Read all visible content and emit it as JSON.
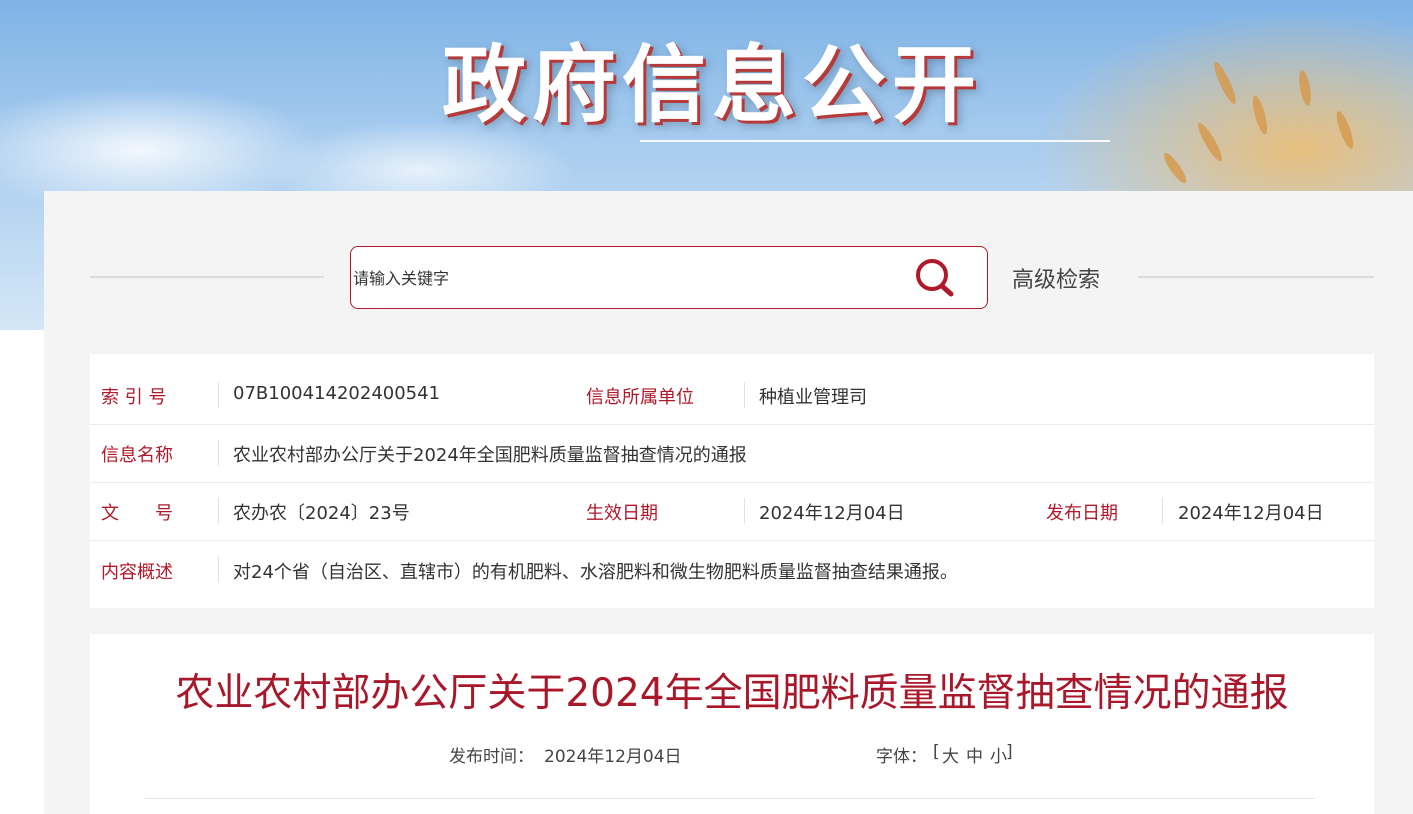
{
  "banner": {
    "title": "政府信息公开"
  },
  "search": {
    "placeholder": "请输入关键字",
    "value": "",
    "advanced_label": "高级检索"
  },
  "info": {
    "index_label": "索 引 号",
    "index_value": "07B100414202400541",
    "unit_label": "信息所属单位",
    "unit_value": "种植业管理司",
    "name_label": "信息名称",
    "name_value": "农业农村部办公厅关于2024年全国肥料质量监督抽查情况的通报",
    "doc_no_label": "文　　号",
    "doc_no_value": "农办农〔2024〕23号",
    "effective_label": "生效日期",
    "effective_value": "2024年12月04日",
    "publish_label": "发布日期",
    "publish_value": "2024年12月04日",
    "summary_label": "内容概述",
    "summary_value": "对24个省（自治区、直辖市）的有机肥料、水溶肥料和微生物肥料质量监督抽查结果通报。"
  },
  "article": {
    "title": "农业农村部办公厅关于2024年全国肥料质量监督抽查情况的通报",
    "publish_time_label": "发布时间：",
    "publish_time_value": "2024年12月04日",
    "font_label": "字体：",
    "font_open": "[",
    "font_large": "大",
    "font_medium": "中",
    "font_small": "小",
    "font_close": "]"
  }
}
